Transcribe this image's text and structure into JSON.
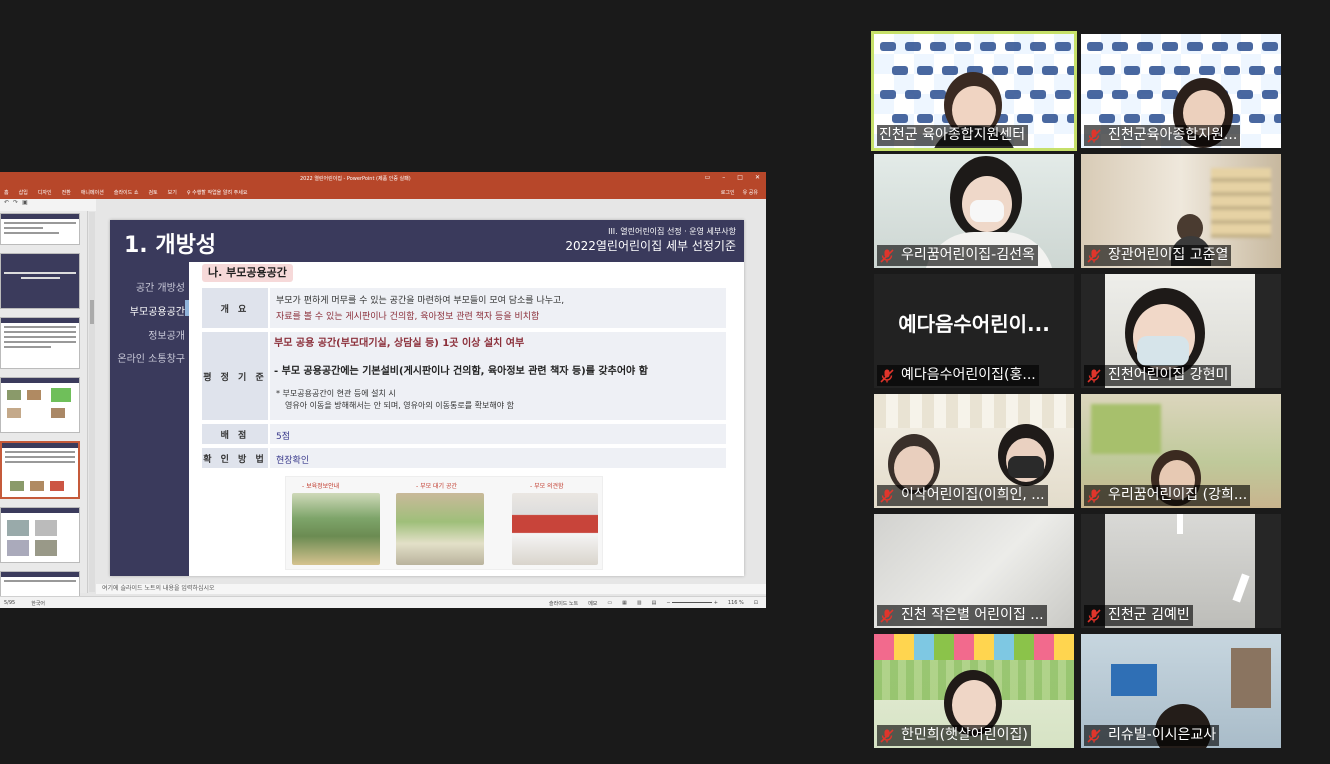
{
  "powerpoint": {
    "window_title": "2022 열린어린이집 - PowerPoint (제품 인증 실패)",
    "ribbon_tabs": [
      "홈",
      "삽입",
      "디자인",
      "전환",
      "애니메이션",
      "슬라이드 쇼",
      "검토",
      "보기",
      "♀ 수행할 작업을 알려 주세요"
    ],
    "ribbon_right": [
      "로그인",
      "유 공유"
    ],
    "notes_placeholder": "여기에 슬라이드 노트의 내용을 입력하십시오",
    "status_slide": "5/95",
    "status_lang": "한국어",
    "status_notes": "슬라이드 노트",
    "status_comments": "메모",
    "zoom": "116 %"
  },
  "slide": {
    "title": "1. 개방성",
    "subtitle_small": "III. 열린어린이집 선정 · 운영 세부사항",
    "subtitle_large": "2022열린어린이집 세부 선정기준",
    "nav": [
      "공간 개방성",
      "부모공용공간",
      "정보공개",
      "온라인 소통창구"
    ],
    "section": "나. 부모공용공간",
    "rows": {
      "overview_label": "개 요",
      "overview_line1": "부모가 편하게 머무를 수 있는 공간을 마련하여 부모들이 모여 담소를 나누고,",
      "overview_line2": "자료를 볼 수 있는 게시판이나 건의함, 육아정보 관련 책자 등을 비치함",
      "criteria_label": "평 정 기 준",
      "criteria_line1": "부모 공용 공간(부모대기실, 상담실 등) 1곳 이상 설치 여부",
      "criteria_line2": "- 부모 공용공간에는 기본설비(게시판이나 건의함, 육아정보 관련 책자 등)를 갖추어야 함",
      "criteria_note1": "*  부모공용공간이 현관 등에 설치 시",
      "criteria_note2": "영유아 이동을 방해해서는 안 되며, 영유아의 이동통로를 확보해야 함",
      "score_label": "배 점",
      "score_value": "5점",
      "method_label": "확 인 방 법",
      "method_value": "현장확인"
    },
    "photo_captions": [
      "- 보육정보안내",
      "- 부모 대기 공간",
      "- 부모 의견함"
    ]
  },
  "participants": [
    {
      "name": "진천군 육아종합지원센터",
      "muted": false,
      "active_speaker": true
    },
    {
      "name": "진천군육아종합지원...",
      "muted": true
    },
    {
      "name": "우리꿈어린이집-김선옥",
      "muted": true
    },
    {
      "name": "장관어린이집 고준열",
      "muted": true
    },
    {
      "name": "예다음수어린이집(홍...",
      "muted": true,
      "video_off_label": "예다음수어린이..."
    },
    {
      "name": "진천어린이집 강현미",
      "muted": true
    },
    {
      "name": "이삭어린이집(이희인, ...",
      "muted": true
    },
    {
      "name": "우리꿈어린이집 (강희...",
      "muted": true
    },
    {
      "name": "진천 작은별 어린이집 ...",
      "muted": true
    },
    {
      "name": "진천군 김예빈",
      "muted": true
    },
    {
      "name": "한민희(햇살어린이집)",
      "muted": true
    },
    {
      "name": "리슈빌-이시은교사",
      "muted": true
    }
  ],
  "colors": {
    "ppt_accent": "#b7472a",
    "slide_navy": "#3a3a5c",
    "active_speaker": "#c6e06a",
    "muted_red": "#e0352b"
  }
}
